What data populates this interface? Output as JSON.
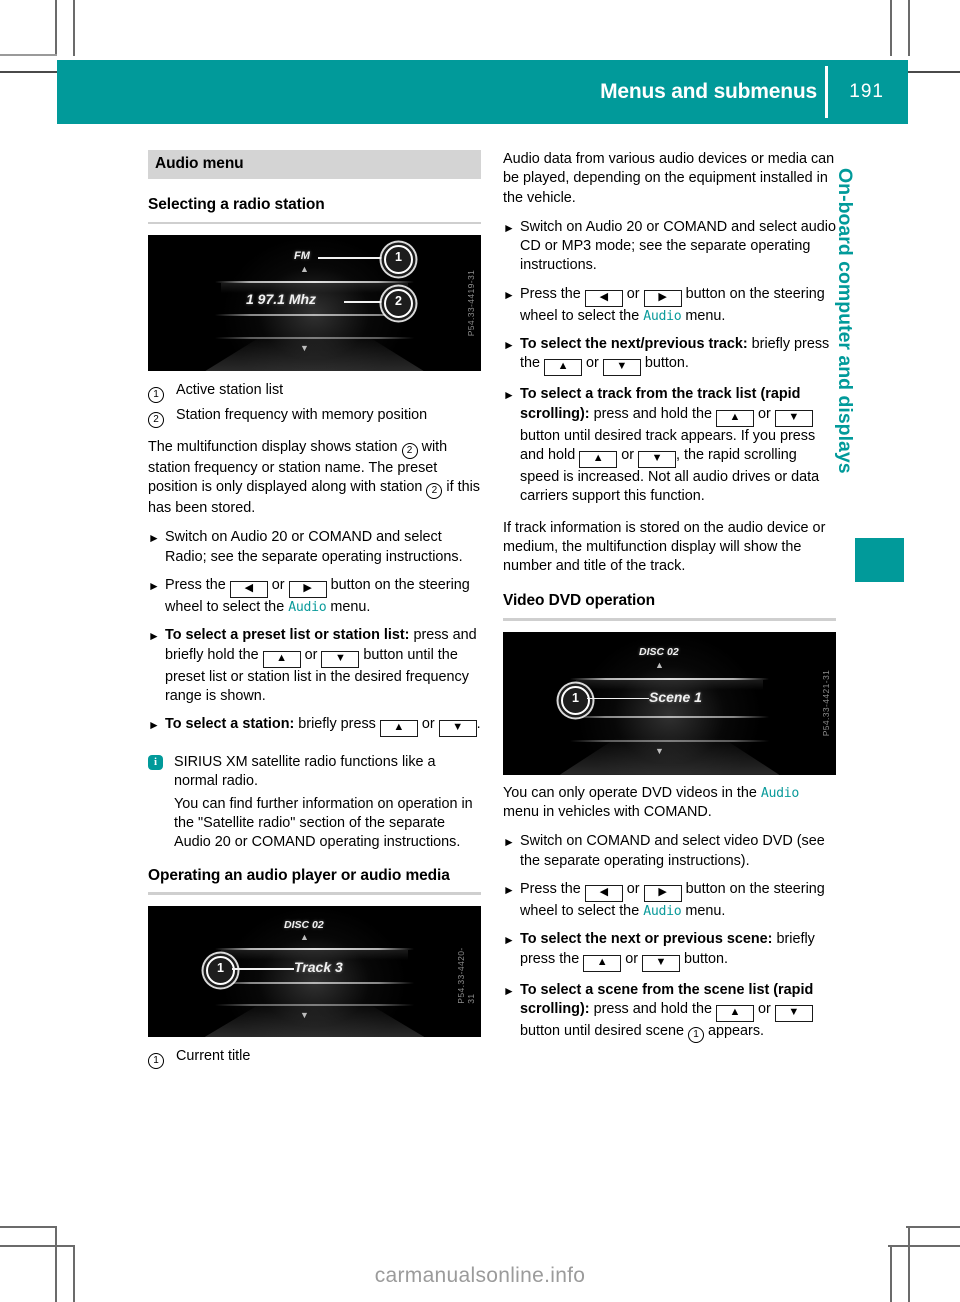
{
  "header": {
    "title": "Menus and submenus",
    "page_number": "191"
  },
  "side_tab": {
    "label": "On-board computer and displays"
  },
  "watermark": "carmanualsonline.info",
  "left_column": {
    "band_title": "Audio menu",
    "section_heading": "Selecting a radio station",
    "radio_figure": {
      "mode_label": "FM",
      "frequency_label": "1 97.1 Mhz",
      "callout_1": "1",
      "callout_2": "2",
      "image_code": "P54.33-4419-31"
    },
    "legend": [
      {
        "num": "1",
        "text": "Active station list"
      },
      {
        "num": "2",
        "text": "Station frequency with memory position"
      }
    ],
    "paragraph_1_a": "The multifunction display shows station",
    "paragraph_1_b": "with station frequency or station name. The preset position is only displayed along with station",
    "paragraph_1_c": "if this has been stored.",
    "steps": [
      {
        "bold": "",
        "text": "Switch on Audio 20 or COMAND and select Radio; see the separate operating instructions."
      },
      {
        "bold": "",
        "text_before": "Press the",
        "key_a": "◀",
        "or": "or",
        "key_b": "▶",
        "text_after": "button on the steering wheel to select the",
        "teal": "Audio",
        "text_end": "menu."
      },
      {
        "bold": "To select a preset list or station list:",
        "text_before": "press and briefly hold the",
        "key_a": "▲",
        "or": "or",
        "key_b": "▼",
        "text_after": "button until the preset list or station list in the desired frequency range is shown."
      },
      {
        "bold": "To select a station:",
        "text_before": "briefly press",
        "key_a": "▲",
        "or": "or",
        "key_b": "▼",
        "text_after": "."
      }
    ],
    "note": {
      "line_1": "SIRIUS XM satellite radio functions like a normal radio.",
      "line_2": "You can find further information on operation in the \"Satellite radio\" section of the separate Audio 20 or COMAND operating instructions."
    },
    "section_heading_2": "Operating an audio player or audio media",
    "audio_figure": {
      "disc_label": "DISC 02",
      "track_label": "Track 3",
      "callout_1": "1",
      "image_code": "P54.33-4420-31"
    },
    "legend_2": [
      {
        "num": "1",
        "text": "Current title"
      }
    ]
  },
  "right_column": {
    "paragraph_1": "Audio data from various audio devices or media can be played, depending on the equipment installed in the vehicle.",
    "steps": [
      {
        "bold": "",
        "text": "Switch on Audio 20 or COMAND and select audio CD or MP3 mode; see the separate operating instructions."
      },
      {
        "bold": "",
        "text_before": "Press the",
        "key_a": "◀",
        "or": "or",
        "key_b": "▶",
        "text_after": "button on the steering wheel to select the",
        "teal": "Audio",
        "text_end": "menu."
      },
      {
        "bold": "To select the next/previous track:",
        "text_before": "briefly press the",
        "key_a": "▲",
        "or": "or",
        "key_b": "▼",
        "text_after": "button."
      },
      {
        "bold": "To select a track from the track list (rapid scrolling):",
        "text_before": "press and hold the",
        "key_a": "▲",
        "or": "or",
        "key_b": "▼",
        "text_after": "button until desired track appears.",
        "text_more_before": "If you press and hold",
        "key_c": "▲",
        "or2": "or",
        "key_d": "▼",
        "text_more_after": ", the rapid scrolling speed is increased. Not all audio drives or data carriers support this function."
      }
    ],
    "paragraph_2": "If track information is stored on the audio device or medium, the multifunction display will show the number and title of the track.",
    "section_heading": "Video DVD operation",
    "dvd_figure": {
      "disc_label": "DISC 02",
      "scene_label": "Scene 1",
      "callout_1": "1",
      "image_code": "P54.33-4421-31"
    },
    "paragraph_3_before": "You can only operate DVD videos in the",
    "paragraph_3_teal": "Audio",
    "paragraph_3_after": "menu in vehicles with COMAND.",
    "steps_2": [
      {
        "bold": "",
        "text": "Switch on COMAND and select video DVD (see the separate operating instructions)."
      },
      {
        "bold": "",
        "text_before": "Press the",
        "key_a": "◀",
        "or": "or",
        "key_b": "▶",
        "text_after": "button on the steering wheel to select the",
        "teal": "Audio",
        "text_end": "menu."
      },
      {
        "bold": "To select the next or previous scene:",
        "text_before": "briefly press the",
        "key_a": "▲",
        "or": "or",
        "key_b": "▼",
        "text_after": "button."
      },
      {
        "bold": "To select a scene from the scene list (rapid scrolling):",
        "text_before": "press and hold the",
        "key_a": "▲",
        "or": "or",
        "key_b": "▼",
        "text_after": "button until desired scene",
        "cnum": "1",
        "text_end": "appears."
      }
    ]
  }
}
